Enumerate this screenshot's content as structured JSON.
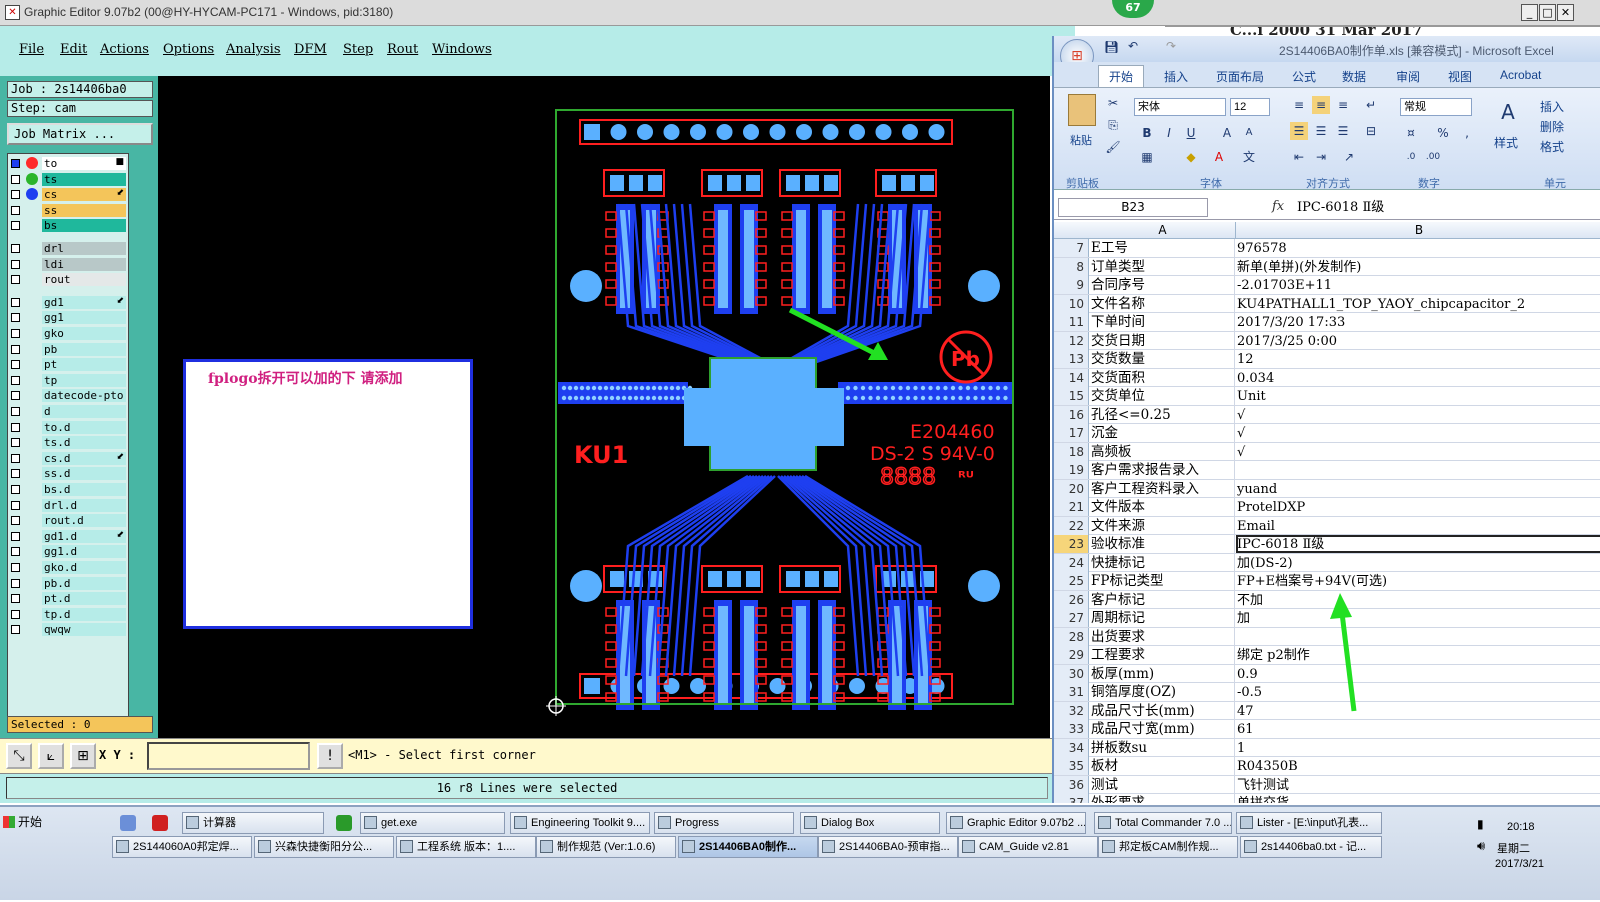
{
  "ge": {
    "title": "Graphic Editor 9.07b2 (00@HY-HYCAM-PC171 - Windows, pid:3180)",
    "badge": "67",
    "behind_text": "C...i 2000 31 Mar 2017",
    "menus": [
      "File",
      "Edit",
      "Actions",
      "Options",
      "Analysis",
      "DFM",
      "Step",
      "Rout",
      "Windows"
    ],
    "job": "Job  : 2s14406ba0",
    "step": "Step: cam",
    "job_matrix": "Job Matrix ...",
    "layers": [
      {
        "name": "to",
        "color": "#ffffff",
        "dot": "#ff2a2a",
        "mark": "■"
      },
      {
        "name": "ts",
        "color": "#1fb89c",
        "dot": "#2ab52a",
        "mark": ""
      },
      {
        "name": "cs",
        "color": "#f4c55a",
        "dot": "#1e3ff0",
        "mark": "⬋"
      },
      {
        "name": "ss",
        "color": "#f4c55a",
        "dot": "",
        "mark": ""
      },
      {
        "name": "bs",
        "color": "#1fb89c",
        "dot": "",
        "mark": ""
      },
      {
        "name": "drl",
        "color": "#b8c8c8",
        "dot": "",
        "mark": ""
      },
      {
        "name": "ldi",
        "color": "#b8c8c8",
        "dot": "",
        "mark": ""
      },
      {
        "name": "rout",
        "color": "#e4e8e8",
        "dot": "",
        "mark": ""
      },
      {
        "name": "gd1",
        "color": "#b6ece8",
        "dot": "",
        "mark": "⬋"
      },
      {
        "name": "gg1",
        "color": "#b6ece8",
        "dot": "",
        "mark": ""
      },
      {
        "name": "gko",
        "color": "#b6ece8",
        "dot": "",
        "mark": ""
      },
      {
        "name": "pb",
        "color": "#b6ece8",
        "dot": "",
        "mark": ""
      },
      {
        "name": "pt",
        "color": "#b6ece8",
        "dot": "",
        "mark": ""
      },
      {
        "name": "tp",
        "color": "#b6ece8",
        "dot": "",
        "mark": ""
      },
      {
        "name": "datecode-pto",
        "color": "#b6ece8",
        "dot": "",
        "mark": ""
      },
      {
        "name": "d",
        "color": "#b6ece8",
        "dot": "",
        "mark": ""
      },
      {
        "name": "to.d",
        "color": "#b6ece8",
        "dot": "",
        "mark": ""
      },
      {
        "name": "ts.d",
        "color": "#b6ece8",
        "dot": "",
        "mark": ""
      },
      {
        "name": "cs.d",
        "color": "#b6ece8",
        "dot": "",
        "mark": "⬋"
      },
      {
        "name": "ss.d",
        "color": "#b6ece8",
        "dot": "",
        "mark": ""
      },
      {
        "name": "bs.d",
        "color": "#b6ece8",
        "dot": "",
        "mark": ""
      },
      {
        "name": "drl.d",
        "color": "#b6ece8",
        "dot": "",
        "mark": ""
      },
      {
        "name": "rout.d",
        "color": "#b6ece8",
        "dot": "",
        "mark": ""
      },
      {
        "name": "gd1.d",
        "color": "#b6ece8",
        "dot": "",
        "mark": "⬋"
      },
      {
        "name": "gg1.d",
        "color": "#b6ece8",
        "dot": "",
        "mark": ""
      },
      {
        "name": "gko.d",
        "color": "#b6ece8",
        "dot": "",
        "mark": ""
      },
      {
        "name": "pb.d",
        "color": "#b6ece8",
        "dot": "",
        "mark": ""
      },
      {
        "name": "pt.d",
        "color": "#b6ece8",
        "dot": "",
        "mark": ""
      },
      {
        "name": "tp.d",
        "color": "#b6ece8",
        "dot": "",
        "mark": ""
      },
      {
        "name": "qwqw",
        "color": "#b6ece8",
        "dot": "",
        "mark": ""
      }
    ],
    "selected": "Selected : 0",
    "note": "fplogo拆开可以加的下   请添加",
    "board": {
      "ku": "KU1",
      "code": "E204460",
      "ds": "DS-2 S 94V-0",
      "date": "8888",
      "pb": "Pb"
    },
    "xy_label": "X Y :",
    "xy_value": "",
    "prompt": "<M1> - Select first corner",
    "status": "16 r8 Lines were selected"
  },
  "excel": {
    "title": "2S14406BA0制作单.xls  [兼容模式] - Microsoft Excel",
    "tabs": [
      "开始",
      "插入",
      "页面布局",
      "公式",
      "数据",
      "审阅",
      "视图",
      "Acrobat"
    ],
    "font_name": "宋体",
    "font_size": "12",
    "number_format": "常规",
    "groups": [
      "剪贴板",
      "字体",
      "对齐方式",
      "数字",
      "单元"
    ],
    "paste": "粘贴",
    "style": "样式",
    "side_cmds": [
      "插入",
      "删除",
      "格式"
    ],
    "name_box": "B23",
    "fx": "fx",
    "formula": "IPC-6018  Ⅱ级",
    "col_a": "A",
    "col_b": "B",
    "rows": [
      {
        "n": "7",
        "a": "E工号",
        "b": "976578"
      },
      {
        "n": "8",
        "a": "订单类型",
        "b": "新单(单拼)(外发制作)"
      },
      {
        "n": "9",
        "a": "合同序号",
        "b": "-2.01703E+11"
      },
      {
        "n": "10",
        "a": "文件名称",
        "b": "KU4PATHALL1_TOP_YAOY_chipcapacitor_2"
      },
      {
        "n": "11",
        "a": "下单时间",
        "b": "2017/3/20 17:33"
      },
      {
        "n": "12",
        "a": "交货日期",
        "b": "2017/3/25 0:00"
      },
      {
        "n": "13",
        "a": "交货数量",
        "b": "12"
      },
      {
        "n": "14",
        "a": "交货面积",
        "b": "0.034"
      },
      {
        "n": "15",
        "a": "交货单位",
        "b": "Unit"
      },
      {
        "n": "16",
        "a": "孔径<=0.25",
        "b": "√"
      },
      {
        "n": "17",
        "a": "沉金",
        "b": "√"
      },
      {
        "n": "18",
        "a": "高频板",
        "b": "√"
      },
      {
        "n": "19",
        "a": "客户需求报告录入",
        "b": ""
      },
      {
        "n": "20",
        "a": "客户工程资料录入",
        "b": "yuand"
      },
      {
        "n": "21",
        "a": "文件版本",
        "b": "ProtelDXP"
      },
      {
        "n": "22",
        "a": "文件来源",
        "b": "Email"
      },
      {
        "n": "23",
        "a": "验收标准",
        "b": "IPC-6018  Ⅱ级"
      },
      {
        "n": "24",
        "a": "快捷标记",
        "b": "加(DS-2)"
      },
      {
        "n": "25",
        "a": "FP标记类型",
        "b": "FP+E档案号+94V(可选)"
      },
      {
        "n": "26",
        "a": "客户标记",
        "b": "不加"
      },
      {
        "n": "27",
        "a": "周期标记",
        "b": "加"
      },
      {
        "n": "28",
        "a": "出货要求",
        "b": ""
      },
      {
        "n": "29",
        "a": "工程要求",
        "b": "绑定 p2制作"
      },
      {
        "n": "30",
        "a": "板厚(mm)",
        "b": "0.9"
      },
      {
        "n": "31",
        "a": "铜箔厚度(OZ)",
        "b": "-0.5"
      },
      {
        "n": "32",
        "a": "成品尺寸长(mm)",
        "b": "47"
      },
      {
        "n": "33",
        "a": "成品尺寸宽(mm)",
        "b": "61"
      },
      {
        "n": "34",
        "a": "拼板数su",
        "b": "1"
      },
      {
        "n": "35",
        "a": "板材",
        "b": "R04350B"
      },
      {
        "n": "36",
        "a": "测试",
        "b": "飞针测试"
      },
      {
        "n": "37",
        "a": "外形要求",
        "b": "单拼交货"
      }
    ]
  },
  "taskbar": {
    "start": "开始",
    "row1": [
      "",
      "计算器",
      "",
      "get.exe",
      "Engineering Toolkit 9....",
      "Progress",
      "Dialog Box",
      "Graphic Editor 9.07b2 ...",
      "Total Commander 7.0 ...",
      "Lister - [E:\\input\\孔表..."
    ],
    "row2": [
      "2S144060A0邦定焊...",
      "兴森快捷衡阳分公...",
      "工程系统  版本：1....",
      "制作规范 (Ver:1.0.6)",
      "2S14406BA0制作...",
      "2S14406BA0-预审指...",
      "CAM_Guide v2.81",
      "邦定板CAM制作规...",
      "2s14406ba0.txt - 记..."
    ],
    "time": "20:18",
    "weekday": "星期二",
    "date": "2017/3/21"
  }
}
